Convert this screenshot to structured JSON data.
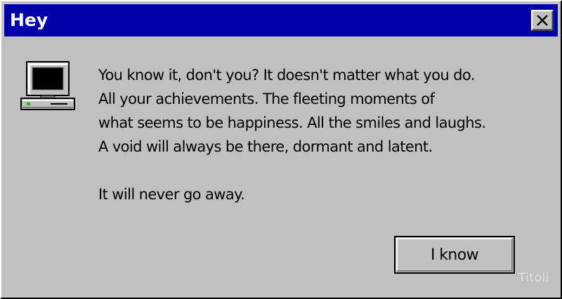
{
  "window": {
    "title": "Hey"
  },
  "icons": {
    "title_close": "close-icon",
    "message": "computer-icon"
  },
  "message": {
    "lines": [
      "You know it, don't you? It doesn't matter what you do.",
      "All your achievements. The fleeting moments of",
      "what seems to be happiness. All the smiles and laughs.",
      "A void will always be there, dormant and latent."
    ],
    "closing": "It will never go away."
  },
  "buttons": {
    "ok_label": "I know"
  },
  "watermark": "Titoli",
  "colors": {
    "titlebar": "#0000a8",
    "face": "#c0c0c0",
    "title_text": "#ffffff"
  }
}
